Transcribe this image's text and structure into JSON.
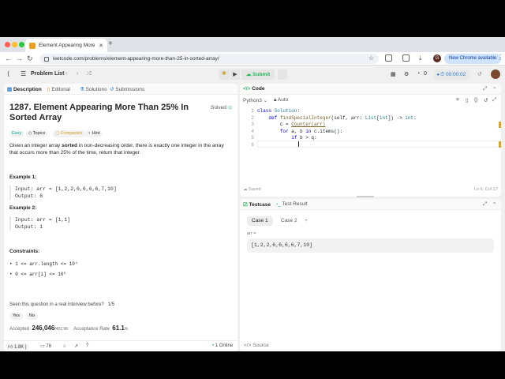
{
  "browser": {
    "tab_title": "Element Appearing More Than 25% In Sorted Array",
    "url": "leetcode.com/problems/element-appearing-more-than-25-in-sorted-array/",
    "new_chrome": "New Chrome available",
    "profile_initial": "G"
  },
  "topnav": {
    "problem_list": "Problem List",
    "submit": "Submit",
    "counter": "0",
    "timer": "00:00:02"
  },
  "left": {
    "tabs": [
      "Description",
      "Editorial",
      "Solutions",
      "Submissions"
    ],
    "title": "1287. Element Appearing More Than 25% In Sorted Array",
    "solved": "Solved",
    "tags": [
      "Easy",
      "Topics",
      "Companies",
      "Hint"
    ],
    "desc_1": "Given an integer array ",
    "desc_bold": "sorted",
    "desc_2": " in non-decreasing order, there is exactly one integer in the array that occurs more than 25% of the time, return that integer.",
    "ex1_head": "Example 1:",
    "ex1_input": "Input: arr = [1,2,2,6,6,6,6,7,10]",
    "ex1_output": "Output: 6",
    "ex2_head": "Example 2:",
    "ex2_input": "Input: arr = [1,1]",
    "ex2_output": "Output: 1",
    "constraints_head": "Constraints:",
    "c1": "1 <= arr.length <= 10⁴",
    "c2": "0 <= arr[i] <= 10⁵",
    "interview_q": "Seen this question in a real interview before?",
    "interview_frac": "1/5",
    "yes": "Yes",
    "no": "No",
    "accepted_label": "Accepted",
    "accepted_value": "246,046",
    "accepted_total": "/402.9K",
    "rate_label": "Acceptance Rate",
    "rate_value": "61.1",
    "rate_unit": "%",
    "likes": "1.8K",
    "comments": "78",
    "online": "1 Online"
  },
  "code": {
    "tab": "Code",
    "language": "Python3",
    "auto": "Auto",
    "lines": [
      "1",
      "2",
      "3",
      "4",
      "5",
      "6"
    ],
    "saved": "Saved",
    "position": "Ln 6, Col 17"
  },
  "test": {
    "tab_testcase": "Testcase",
    "tab_result": "Test Result",
    "case1": "Case 1",
    "case2": "Case 2",
    "plus": "+",
    "var_label": "arr =",
    "input_value": "[1,2,2,6,6,6,6,7,10]",
    "source": "Source"
  }
}
